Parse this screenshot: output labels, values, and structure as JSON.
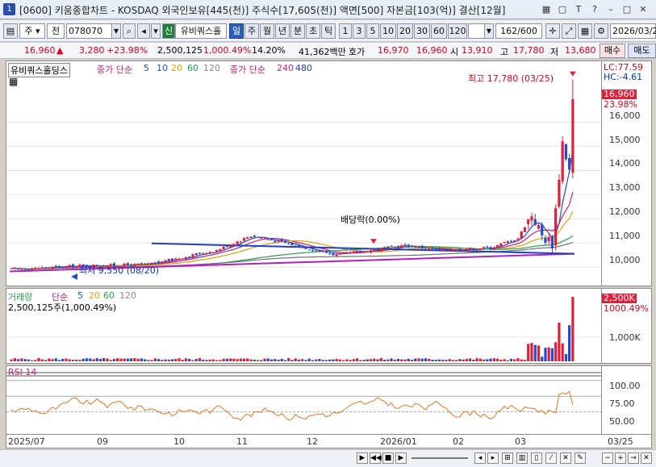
{
  "window": {
    "badge": "1",
    "title": "[0600] 키움종합차트 - KOSDAQ 외국인보유[445(천)] 주식수[17,605(천)] 액면[500] 자본금[103(억)] 결산[12월]",
    "btn_grid": "▦",
    "btn_pin": "▢",
    "btn_help": "?",
    "btn_tip": "ꟷ",
    "btn_minimize": "–",
    "btn_maximize": "□",
    "btn_close": "✕",
    "btn_menu": "T"
  },
  "toolbar": {
    "period_label": "주",
    "prev_label": "전",
    "code": "078070",
    "sin": "신",
    "stock_name": "유비쿼스홀",
    "periods": [
      "일",
      "주",
      "월",
      "년",
      "분",
      "초",
      "틱"
    ],
    "active_period": "일",
    "nums": [
      "1",
      "3",
      "5",
      "10",
      "20",
      "30",
      "60",
      "120"
    ],
    "count": "162",
    "count_total": "/600",
    "date": "2026/03/2"
  },
  "quote": {
    "price": "16,960",
    "up_arrow": "▲",
    "change": "3,280",
    "change_pct": "+23.98%",
    "volume": "2,500,125",
    "vol_ratio": "1,000.49%",
    "turnover": "14.20%",
    "amount": "41,362백만",
    "hoga_label": "호가",
    "ask": "16,970",
    "bid": "16,960",
    "open_label": "시",
    "open": "13,910",
    "high_label": "고",
    "high": "17,780",
    "low_label": "저",
    "low": "13,680",
    "buy_label": "매수",
    "sell_label": "매도"
  },
  "price_panel": {
    "stock_label": "유비쿼스홀딩스",
    "ma_group1": "종가 단순",
    "ma_periods1": [
      "5",
      "10",
      "20",
      "60",
      "120"
    ],
    "ma_group2": "종가 단순",
    "ma_periods2": [
      "240",
      "480"
    ],
    "lc": "LC:77.59",
    "hc": "HC:-4.61",
    "current_tag": "16,960",
    "current_pct": "23.98%",
    "high_note": "최고 17,780 (03/25)",
    "low_note": "최저 9,550 (08/20)",
    "dividend_note": "배당락(0.00%)",
    "y_ticks": [
      "16,000",
      "15,000",
      "14,000",
      "13,000",
      "12,000",
      "11,000",
      "10,000"
    ]
  },
  "volume_panel": {
    "label": "거래량",
    "ma_group": "단순",
    "ma_periods": [
      "5",
      "20",
      "60",
      "120"
    ],
    "value": "2,500,125주(1,000.49%)",
    "tag": "2,500K",
    "tag_pct": "1000.49%",
    "y_ticks": [
      "1,000K"
    ]
  },
  "rsi_panel": {
    "label": "RSI 14",
    "y_ticks": [
      "100.00",
      "75.00",
      "50.00"
    ]
  },
  "x_axis": {
    "dates": [
      "2025/07",
      "09",
      "10",
      "11",
      "12",
      "2026/01",
      "02",
      "03",
      "03/25"
    ]
  },
  "colors": {
    "up": "#e0203a",
    "down": "#1f4fd0",
    "ma5": "#1f4fd0",
    "ma10": "#c5207a",
    "ma20": "#e0a000",
    "ma60": "#27a050",
    "ma120": "#707070",
    "ma240": "#1f3fc0",
    "ma480": "#b020c0",
    "rsi": "#e6751a"
  },
  "chart_data": {
    "type": "candlestick",
    "price_range": [
      9500,
      17800
    ],
    "high": 17780,
    "low": 9550,
    "last_close": 16960,
    "volume_last": 2500125,
    "rsi_last": 62
  }
}
